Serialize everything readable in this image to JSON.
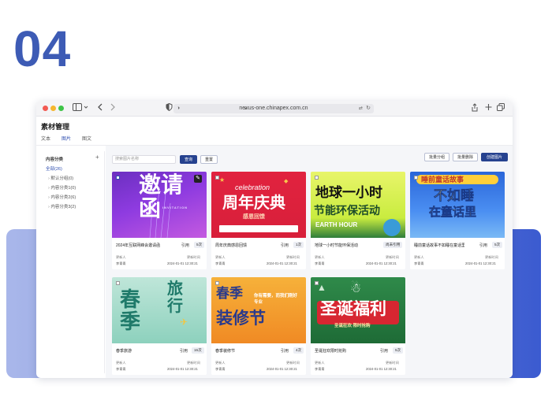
{
  "heading": {
    "number": "04"
  },
  "browser": {
    "url": "nexus-one.chinapex.com.cn",
    "sidebar_toggle_icon": "sidebar-icon",
    "back_icon": "chevron-left-icon",
    "forward_icon": "chevron-right-icon",
    "shield_icon": "shield-icon",
    "share_icon": "share-icon",
    "new_tab_icon": "plus-icon",
    "tabs_icon": "tabs-icon"
  },
  "app": {
    "title": "素材管理",
    "tabs": [
      {
        "label": "文本",
        "active": false
      },
      {
        "label": "图片",
        "active": true
      },
      {
        "label": "图文",
        "active": false
      }
    ]
  },
  "sidebar": {
    "header": "内容分类",
    "all": "全部(26)",
    "items": [
      {
        "label": "默认分组(0)"
      },
      {
        "label": "内容分类1(0)"
      },
      {
        "label": "内容分类2(6)"
      },
      {
        "label": "内容分类3(2)"
      }
    ]
  },
  "toolbar": {
    "search_placeholder": "搜索图片名称",
    "query_btn": "查询",
    "reset_btn": "重置",
    "batch_group_btn": "批量分组",
    "batch_delete_btn": "批量删除",
    "create_btn": "创建图片"
  },
  "meta_labels": {
    "updater": "更新人",
    "update_time": "更新时间",
    "ref_label": "引用"
  },
  "cards": [
    {
      "title": "2024年互联网峰会邀请函",
      "ref": "引用",
      "badge": "5次",
      "updater": "李青青",
      "time": "2024-01-01 12:30:21",
      "poster_main": "邀请函",
      "poster_sub": "INVITATION"
    },
    {
      "title": "周年庆典感恩回馈",
      "ref": "引用",
      "badge": "1次",
      "updater": "李青青",
      "time": "2024-01-01 12:30:21",
      "poster_top": "celebration",
      "poster_main": "周年庆典",
      "poster_sub": "感恩回馈"
    },
    {
      "title": "地球一小时节能环保活动",
      "ref": "",
      "badge": "尚未引用",
      "updater": "李青青",
      "time": "2024-01-01 12:30:21",
      "poster_main": "地球一小时",
      "poster_line2": "节能环保活动",
      "poster_sub": "EARTH HOUR"
    },
    {
      "title": "睡前童话故事不如睡在童话里",
      "ref": "引用",
      "badge": "5次",
      "updater": "李青青",
      "time": "2024-01-01 12:30:21",
      "poster_top": "睡前童话故事",
      "poster_main": "不如睡",
      "poster_line2": "在童话里"
    },
    {
      "title": "春季旅游",
      "ref": "引用",
      "badge": "16次",
      "updater": "李青青",
      "time": "2024-01-01 12:30:21",
      "poster_main": "春季",
      "poster_line2": "旅行"
    },
    {
      "title": "春季装修节",
      "ref": "引用",
      "badge": "4次",
      "updater": "李青青",
      "time": "2024-01-01 12:30:21",
      "poster_main": "春季",
      "poster_line2": "装修节",
      "poster_sub": "你有需要，而我们刚好专业"
    },
    {
      "title": "圣诞狂欢限时抢购",
      "ref": "引用",
      "badge": "5次",
      "updater": "李青青",
      "time": "2024-01-01 12:30:21",
      "poster_main": "圣诞福利",
      "poster_sub": "圣诞狂欢 限时抢购"
    }
  ]
}
